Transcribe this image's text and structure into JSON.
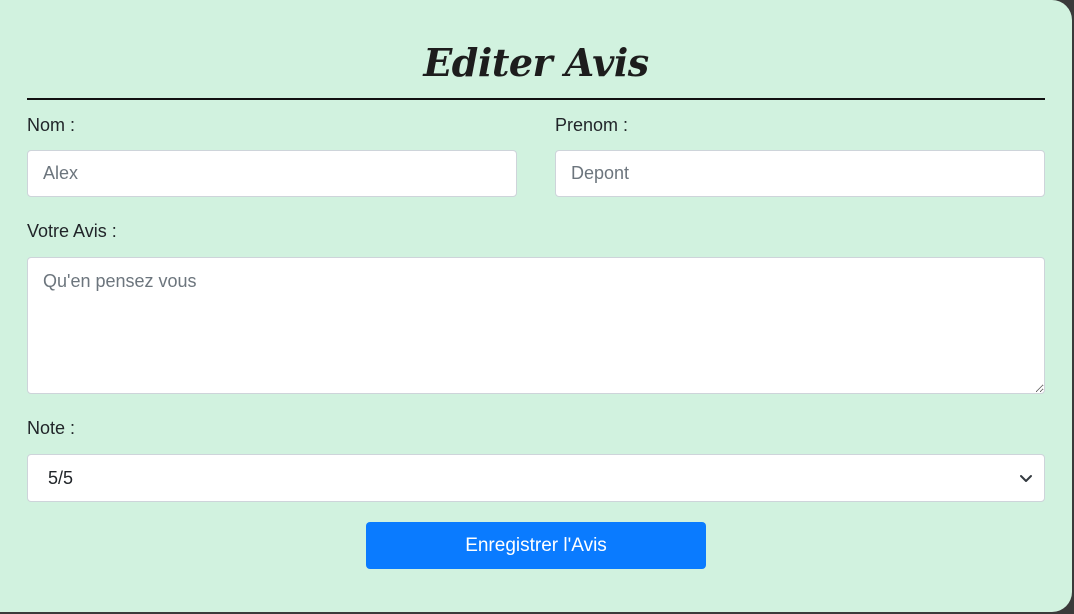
{
  "form": {
    "title": "Editer Avis",
    "nom": {
      "label": "Nom :",
      "placeholder": "Alex"
    },
    "prenom": {
      "label": "Prenom :",
      "placeholder": "Depont"
    },
    "avis": {
      "label": "Votre Avis :",
      "placeholder": "Qu'en pensez vous"
    },
    "note": {
      "label": "Note :",
      "selected": "5/5"
    },
    "submit_label": "Enregistrer l'Avis"
  },
  "colors": {
    "background": "#d1f2df",
    "button": "#0a7bff"
  },
  "icons": {
    "select": "chevron-down-icon",
    "resize": "resize-handle-icon"
  }
}
